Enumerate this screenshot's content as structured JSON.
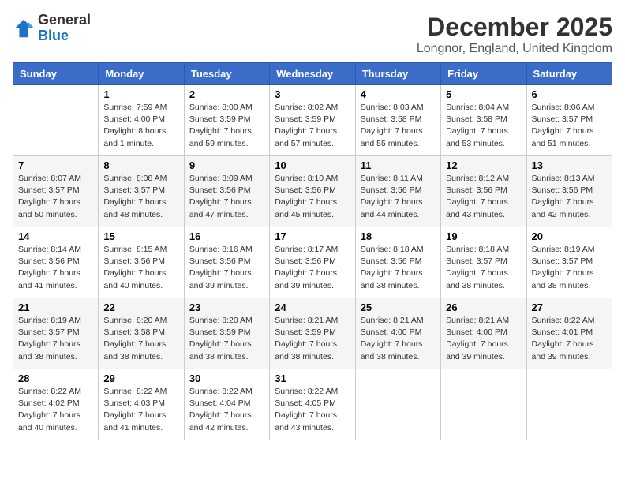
{
  "header": {
    "logo": {
      "general": "General",
      "blue": "Blue"
    },
    "title": "December 2025",
    "location": "Longnor, England, United Kingdom"
  },
  "weekdays": [
    "Sunday",
    "Monday",
    "Tuesday",
    "Wednesday",
    "Thursday",
    "Friday",
    "Saturday"
  ],
  "weeks": [
    [
      {
        "day": "",
        "info": ""
      },
      {
        "day": "1",
        "info": "Sunrise: 7:59 AM\nSunset: 4:00 PM\nDaylight: 8 hours\nand 1 minute."
      },
      {
        "day": "2",
        "info": "Sunrise: 8:00 AM\nSunset: 3:59 PM\nDaylight: 7 hours\nand 59 minutes."
      },
      {
        "day": "3",
        "info": "Sunrise: 8:02 AM\nSunset: 3:59 PM\nDaylight: 7 hours\nand 57 minutes."
      },
      {
        "day": "4",
        "info": "Sunrise: 8:03 AM\nSunset: 3:58 PM\nDaylight: 7 hours\nand 55 minutes."
      },
      {
        "day": "5",
        "info": "Sunrise: 8:04 AM\nSunset: 3:58 PM\nDaylight: 7 hours\nand 53 minutes."
      },
      {
        "day": "6",
        "info": "Sunrise: 8:06 AM\nSunset: 3:57 PM\nDaylight: 7 hours\nand 51 minutes."
      }
    ],
    [
      {
        "day": "7",
        "info": "Sunrise: 8:07 AM\nSunset: 3:57 PM\nDaylight: 7 hours\nand 50 minutes."
      },
      {
        "day": "8",
        "info": "Sunrise: 8:08 AM\nSunset: 3:57 PM\nDaylight: 7 hours\nand 48 minutes."
      },
      {
        "day": "9",
        "info": "Sunrise: 8:09 AM\nSunset: 3:56 PM\nDaylight: 7 hours\nand 47 minutes."
      },
      {
        "day": "10",
        "info": "Sunrise: 8:10 AM\nSunset: 3:56 PM\nDaylight: 7 hours\nand 45 minutes."
      },
      {
        "day": "11",
        "info": "Sunrise: 8:11 AM\nSunset: 3:56 PM\nDaylight: 7 hours\nand 44 minutes."
      },
      {
        "day": "12",
        "info": "Sunrise: 8:12 AM\nSunset: 3:56 PM\nDaylight: 7 hours\nand 43 minutes."
      },
      {
        "day": "13",
        "info": "Sunrise: 8:13 AM\nSunset: 3:56 PM\nDaylight: 7 hours\nand 42 minutes."
      }
    ],
    [
      {
        "day": "14",
        "info": "Sunrise: 8:14 AM\nSunset: 3:56 PM\nDaylight: 7 hours\nand 41 minutes."
      },
      {
        "day": "15",
        "info": "Sunrise: 8:15 AM\nSunset: 3:56 PM\nDaylight: 7 hours\nand 40 minutes."
      },
      {
        "day": "16",
        "info": "Sunrise: 8:16 AM\nSunset: 3:56 PM\nDaylight: 7 hours\nand 39 minutes."
      },
      {
        "day": "17",
        "info": "Sunrise: 8:17 AM\nSunset: 3:56 PM\nDaylight: 7 hours\nand 39 minutes."
      },
      {
        "day": "18",
        "info": "Sunrise: 8:18 AM\nSunset: 3:56 PM\nDaylight: 7 hours\nand 38 minutes."
      },
      {
        "day": "19",
        "info": "Sunrise: 8:18 AM\nSunset: 3:57 PM\nDaylight: 7 hours\nand 38 minutes."
      },
      {
        "day": "20",
        "info": "Sunrise: 8:19 AM\nSunset: 3:57 PM\nDaylight: 7 hours\nand 38 minutes."
      }
    ],
    [
      {
        "day": "21",
        "info": "Sunrise: 8:19 AM\nSunset: 3:57 PM\nDaylight: 7 hours\nand 38 minutes."
      },
      {
        "day": "22",
        "info": "Sunrise: 8:20 AM\nSunset: 3:58 PM\nDaylight: 7 hours\nand 38 minutes."
      },
      {
        "day": "23",
        "info": "Sunrise: 8:20 AM\nSunset: 3:59 PM\nDaylight: 7 hours\nand 38 minutes."
      },
      {
        "day": "24",
        "info": "Sunrise: 8:21 AM\nSunset: 3:59 PM\nDaylight: 7 hours\nand 38 minutes."
      },
      {
        "day": "25",
        "info": "Sunrise: 8:21 AM\nSunset: 4:00 PM\nDaylight: 7 hours\nand 38 minutes."
      },
      {
        "day": "26",
        "info": "Sunrise: 8:21 AM\nSunset: 4:00 PM\nDaylight: 7 hours\nand 39 minutes."
      },
      {
        "day": "27",
        "info": "Sunrise: 8:22 AM\nSunset: 4:01 PM\nDaylight: 7 hours\nand 39 minutes."
      }
    ],
    [
      {
        "day": "28",
        "info": "Sunrise: 8:22 AM\nSunset: 4:02 PM\nDaylight: 7 hours\nand 40 minutes."
      },
      {
        "day": "29",
        "info": "Sunrise: 8:22 AM\nSunset: 4:03 PM\nDaylight: 7 hours\nand 41 minutes."
      },
      {
        "day": "30",
        "info": "Sunrise: 8:22 AM\nSunset: 4:04 PM\nDaylight: 7 hours\nand 42 minutes."
      },
      {
        "day": "31",
        "info": "Sunrise: 8:22 AM\nSunset: 4:05 PM\nDaylight: 7 hours\nand 43 minutes."
      },
      {
        "day": "",
        "info": ""
      },
      {
        "day": "",
        "info": ""
      },
      {
        "day": "",
        "info": ""
      }
    ]
  ]
}
